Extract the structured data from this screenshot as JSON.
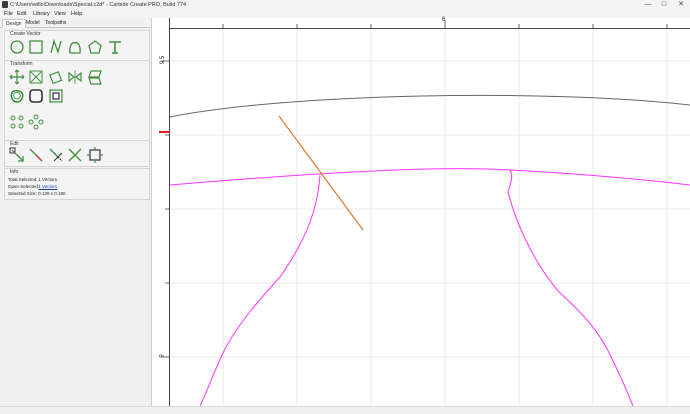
{
  "window": {
    "title": "C:\\Users\\willo\\Downloads\\Special.c2d* - Carbide Create PRO, Build 774",
    "minimize": "—",
    "maximize": "□",
    "close": "✕"
  },
  "menu": {
    "items": [
      "File",
      "Edit",
      "Library",
      "View",
      "Help"
    ]
  },
  "tabs": [
    "Design",
    "Model",
    "Toolpaths"
  ],
  "sections": {
    "create_vector": "Create Vector",
    "transform": "Transform",
    "edit": "Edit",
    "info": "Info"
  },
  "info": {
    "total_selected_label": "Total Selected:",
    "total_selected_value": "1 Vectors",
    "open_selected_label": "Open Selected:",
    "open_selected_value": "1 Vectors",
    "selected_size_label": "Selected Size:",
    "selected_size_value": "0.139 x 0.190"
  },
  "rulers": {
    "top_label": "6",
    "left_label_top": "9.5",
    "left_label_bottom": "9"
  },
  "colors": {
    "accent": "#3f8f3f",
    "selected_vector": "#e07a2a",
    "toolpath_vector": "#ff33ff",
    "stock_arc": "#666666",
    "ruler_marker": "#e02020"
  },
  "icons": {
    "create_vector": [
      "circle-icon",
      "rectangle-icon",
      "polyline-icon",
      "curve-icon",
      "polygon-icon",
      "text-icon"
    ],
    "transform": [
      "move-icon",
      "scale-icon",
      "rotate-icon",
      "mirror-icon",
      "skew-icon",
      "offset-icon",
      "round-corner-icon",
      "inset-icon",
      "array-icon",
      "circular-array-icon"
    ],
    "edit": [
      "node-edit-icon",
      "trim-icon",
      "extend-icon",
      "cut-icon",
      "join-icon"
    ]
  }
}
